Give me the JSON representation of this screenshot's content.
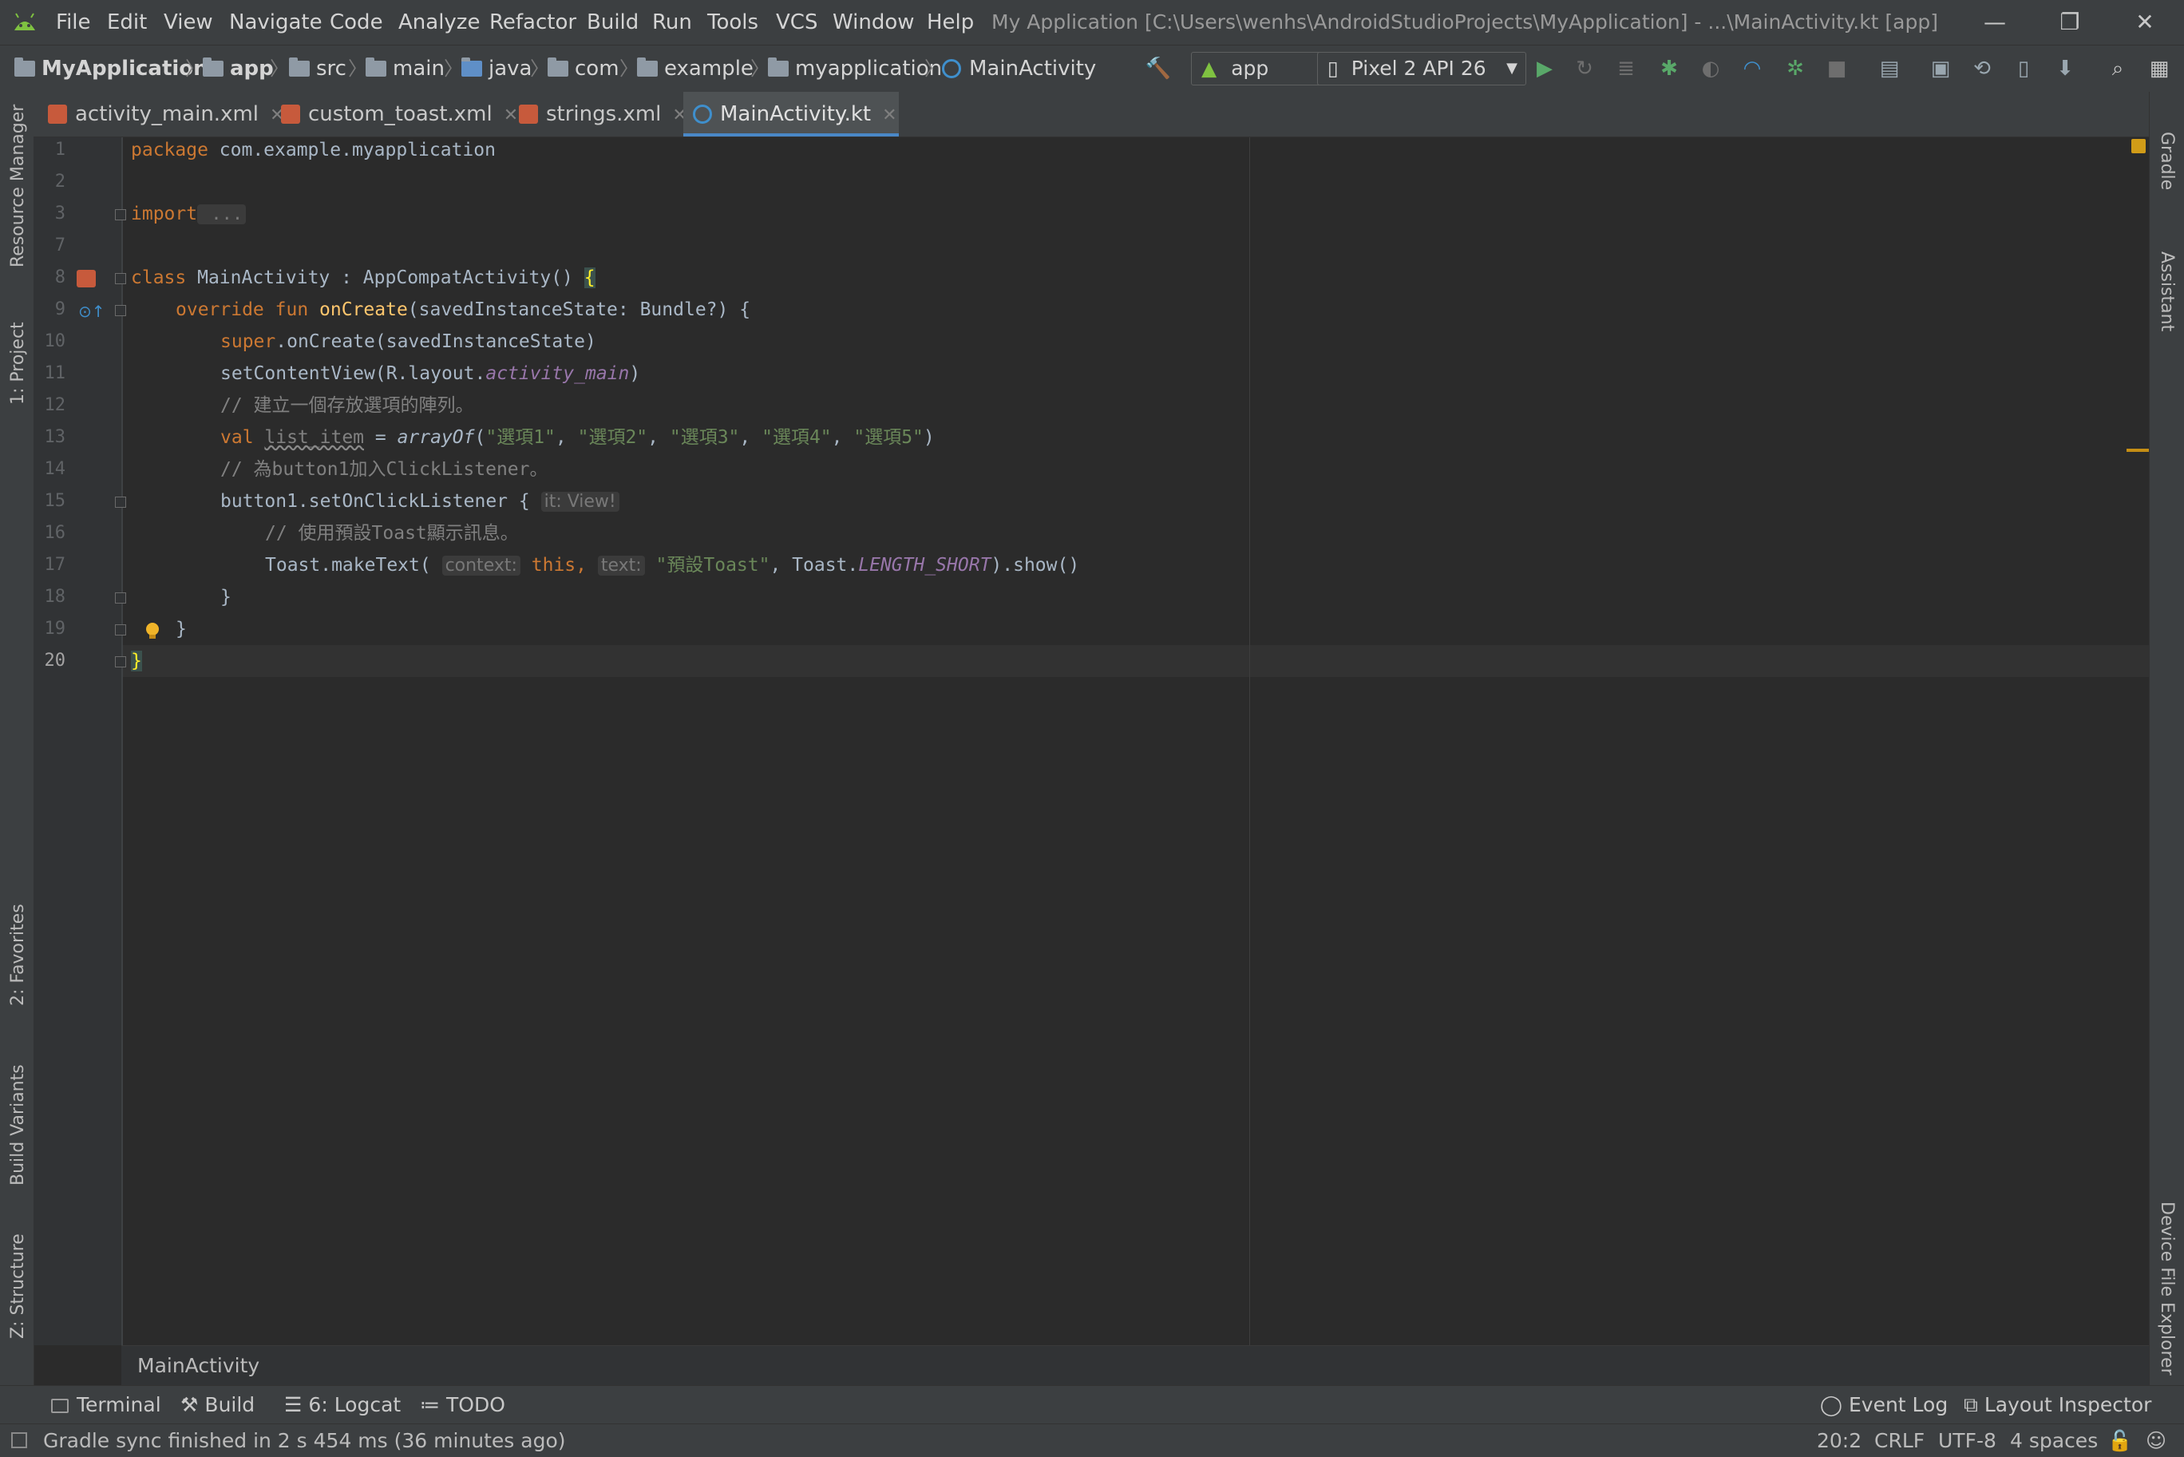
{
  "menubar": {
    "items": [
      "File",
      "Edit",
      "View",
      "Navigate",
      "Code",
      "Analyze",
      "Refactor",
      "Build",
      "Run",
      "Tools",
      "VCS",
      "Window",
      "Help"
    ],
    "window_title": "My Application [C:\\Users\\wenhs\\AndroidStudioProjects\\MyApplication] - ...\\MainActivity.kt [app]"
  },
  "breadcrumbs": [
    "MyApplication",
    "app",
    "src",
    "main",
    "java",
    "com",
    "example",
    "myapplication",
    "MainActivity"
  ],
  "toolbar": {
    "run_config": "app",
    "device": "Pixel 2 API 26"
  },
  "tabs": [
    {
      "label": "activity_main.xml",
      "icon": "xml-file-icon",
      "active": false
    },
    {
      "label": "custom_toast.xml",
      "icon": "xml-file-icon",
      "active": false
    },
    {
      "label": "strings.xml",
      "icon": "xml-file-icon",
      "active": false
    },
    {
      "label": "MainActivity.kt",
      "icon": "kotlin-class-icon",
      "active": true
    }
  ],
  "left_tools": [
    "Resource Manager",
    "1: Project",
    "2: Favorites",
    "Build Variants",
    "Z: Structure"
  ],
  "right_tools": [
    "Gradle",
    "Assistant",
    "Device File Explorer"
  ],
  "editor": {
    "line_numbers": [
      "1",
      "2",
      "3",
      "7",
      "8",
      "9",
      "10",
      "11",
      "12",
      "13",
      "14",
      "15",
      "16",
      "17",
      "18",
      "19",
      "20"
    ],
    "current_line": "20",
    "lines": {
      "l1_kw": "package",
      "l1_rest": " com.example.myapplication",
      "l3_kw": "import",
      "l3_rest": " ...",
      "l8_kw": "class",
      "l8_rest": " MainActivity : AppCompatActivity() ",
      "l8_brace": "{",
      "l9_kw": "override fun ",
      "l9_fn": "onCreate",
      "l9_rest": "(savedInstanceState: Bundle?) {",
      "l10_kw": "super",
      "l10_rest": ".onCreate(savedInstanceState)",
      "l11_a": "setContentView(R.layout.",
      "l11_it": "activity_main",
      "l11_b": ")",
      "l12_cm": "// 建立一個存放選項的陣列。",
      "l13_kw": "val ",
      "l13_var": "list_item",
      "l13_eq": " = ",
      "l13_fn": "arrayOf",
      "l13_open": "(",
      "l13_s1": "\"選項1\"",
      "l13_s2": "\"選項2\"",
      "l13_s3": "\"選項3\"",
      "l13_s4": "\"選項4\"",
      "l13_s5": "\"選項5\"",
      "l13_comma": ", ",
      "l13_close": ")",
      "l14_cm": "// 為button1加入ClickListener。",
      "l15_a": "button1.setOnClickListener { ",
      "l15_hint": "it: View!",
      "l16_cm": "// 使用預設Toast顯示訊息。",
      "l17_a": "Toast.makeText( ",
      "l17_hint1": "context:",
      "l17_this": " this, ",
      "l17_hint2": "text:",
      "l17_str": " \"預設Toast\"",
      "l17_b": ", Toast.",
      "l17_it": "LENGTH_SHORT",
      "l17_c": ").show()",
      "l18": "}",
      "l19": "}",
      "l20": "}"
    }
  },
  "editor_breadcrumb": "MainActivity",
  "bottom_tools": [
    {
      "label": "Terminal",
      "icon": "terminal-icon"
    },
    {
      "label": "Build",
      "icon": "hammer-icon"
    },
    {
      "label": "6: Logcat",
      "icon": "logcat-icon"
    },
    {
      "label": "TODO",
      "icon": "list-icon"
    }
  ],
  "bottom_tools_right": [
    {
      "label": "Event Log",
      "icon": "event-log-icon"
    },
    {
      "label": "Layout Inspector",
      "icon": "layout-inspector-icon"
    }
  ],
  "status": {
    "message": "Gradle sync finished in 2 s 454 ms (36 minutes ago)",
    "position": "20:2",
    "line_separator": "CRLF",
    "encoding": "UTF-8",
    "indent": "4 spaces"
  },
  "colors": {
    "background": "#2b2b2b",
    "chrome": "#3c3f41",
    "keyword": "#cc7832",
    "string": "#6a8759",
    "function": "#ffc66d",
    "accent": "#4a88c7"
  }
}
